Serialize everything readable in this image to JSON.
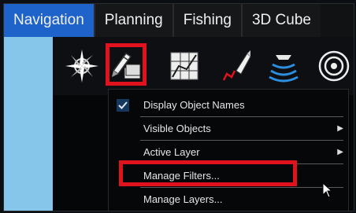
{
  "tabs": [
    "Navigation",
    "Planning",
    "Fishing",
    "3D Cube"
  ],
  "toolbar": {
    "icons": [
      "compass-rose-icon",
      "pencil-layers-icon",
      "chart-grid-icon",
      "track-boat-icon",
      "sonar-icon",
      "target-icon"
    ]
  },
  "menu": {
    "items": [
      {
        "label": "Display Object Names",
        "checked": true,
        "submenu": false
      },
      {
        "label": "Visible Objects",
        "checked": false,
        "submenu": true
      },
      {
        "label": "Active Layer",
        "checked": false,
        "submenu": true
      },
      {
        "label": "Manage Filters...",
        "checked": false,
        "submenu": false
      },
      {
        "label": "Manage Layers...",
        "checked": false,
        "submenu": false
      }
    ]
  },
  "colors": {
    "active_tab": "#1e63c9",
    "highlight": "#e0121d",
    "map_water": "#86c6ea",
    "check_box": "#16385c"
  }
}
